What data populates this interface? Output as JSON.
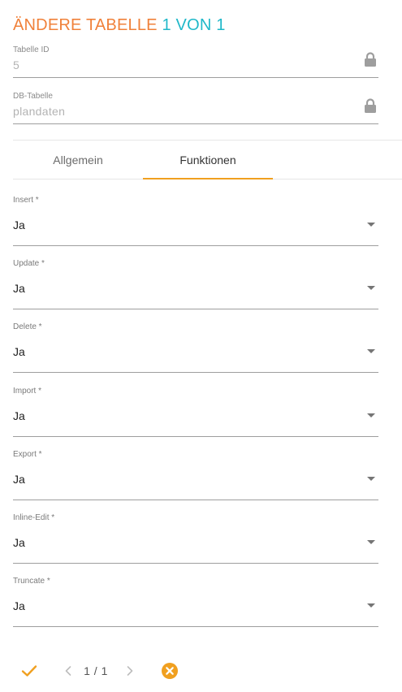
{
  "header": {
    "title": "ÄNDERE TABELLE",
    "count": "1 VON 1"
  },
  "readonly_fields": [
    {
      "label": "Tabelle ID",
      "value": "5"
    },
    {
      "label": "DB-Tabelle",
      "value": "plandaten"
    }
  ],
  "tabs": [
    {
      "label": "Allgemein",
      "active": false
    },
    {
      "label": "Funktionen",
      "active": true
    }
  ],
  "fields": [
    {
      "label": "Insert *",
      "value": "Ja"
    },
    {
      "label": "Update *",
      "value": "Ja"
    },
    {
      "label": "Delete *",
      "value": "Ja"
    },
    {
      "label": "Import *",
      "value": "Ja"
    },
    {
      "label": "Export *",
      "value": "Ja"
    },
    {
      "label": "Inline-Edit *",
      "value": "Ja"
    },
    {
      "label": "Truncate *",
      "value": "Ja"
    }
  ],
  "footer": {
    "pager": "1 / 1",
    "icons": [
      "check-icon",
      "chevron-left-icon",
      "chevron-right-icon",
      "cancel-icon"
    ]
  },
  "colors": {
    "title_orange": "#f0813a",
    "title_teal": "#1fb8c9",
    "accent": "#f0a020"
  }
}
